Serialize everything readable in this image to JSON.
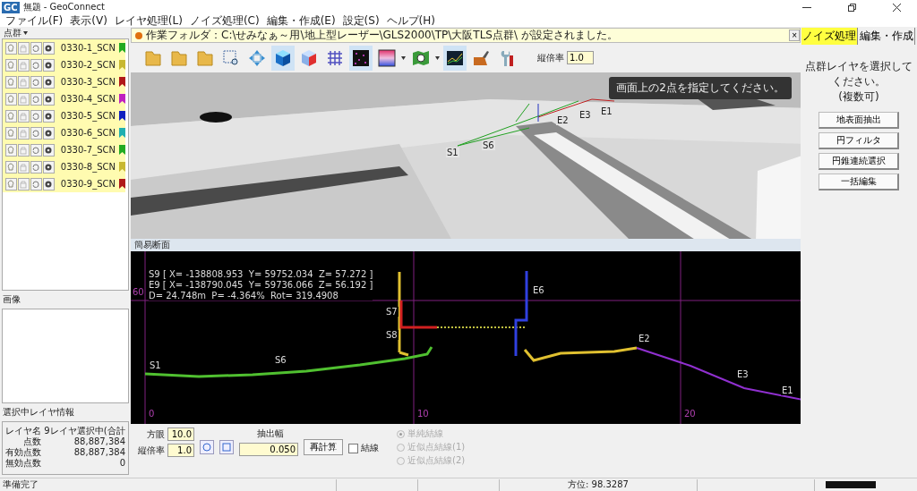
{
  "window": {
    "app_icon": "GC",
    "title": "無題 - GeoConnect"
  },
  "menu": [
    "ファイル(F)",
    "表示(V)",
    "レイヤ処理(L)",
    "ノイズ処理(C)",
    "編集・作成(E)",
    "設定(S)",
    "ヘルプ(H)"
  ],
  "left_panel": {
    "header": "点群",
    "layers": [
      {
        "name": "0330-1_SCN",
        "color": "#22aa22"
      },
      {
        "name": "0330-2_SCN",
        "color": "#c8b830"
      },
      {
        "name": "0330-3_SCN",
        "color": "#b01818"
      },
      {
        "name": "0330-4_SCN",
        "color": "#c020c0"
      },
      {
        "name": "0330-5_SCN",
        "color": "#1020c0"
      },
      {
        "name": "0330-6_SCN",
        "color": "#20b0b0"
      },
      {
        "name": "0330-7_SCN",
        "color": "#22aa22"
      },
      {
        "name": "0330-8_SCN",
        "color": "#c8b830"
      },
      {
        "name": "0330-9_SCN",
        "color": "#b01818"
      }
    ],
    "image_label": "画像",
    "info_label": "選択中レイヤ情報",
    "info": [
      {
        "label": "レイヤ名",
        "value": "9レイヤ選択中(合計"
      },
      {
        "label": "点数",
        "value": "88,887,384"
      },
      {
        "label": "有効点数",
        "value": "88,887,384"
      },
      {
        "label": "無効点数",
        "value": "0"
      }
    ]
  },
  "notice": {
    "text": "作業フォルダ：C:\\せみなぁ～用\\地上型レーザー\\GLS2000\\TP\\大阪TLS点群\\ が設定されました。",
    "close": "×"
  },
  "toolbar": {
    "scale_label": "縦倍率",
    "scale_value": "1.0"
  },
  "view3d": {
    "message": "画面上の2点を指定してください。",
    "points": [
      "S1",
      "S6",
      "E2",
      "E3",
      "E1"
    ]
  },
  "section": {
    "title": "簡易断面",
    "readout": [
      "S9 [ X= -138808.953  Y= 59752.034  Z= 57.272 ]",
      "E9 [ X= -138790.045  Y= 59736.066  Z= 56.192 ]",
      "D= 24.748m  P= -4.364%  Rot= 319.4908"
    ],
    "y_tick": "60",
    "x_ticks": [
      "0",
      "10",
      "20"
    ],
    "markers": [
      "S1",
      "S6",
      "S7",
      "S8",
      "E6",
      "E2",
      "E3",
      "E1"
    ]
  },
  "controls": {
    "grid_label": "方眼",
    "grid_value": "10.0",
    "scale_label": "縦倍率",
    "scale_value": "1.0",
    "width_label": "抽出幅",
    "width_value": "0.050",
    "recalc": "再計算",
    "connect": {
      "label": "結線",
      "checked": false
    },
    "modes_disabled": true,
    "modes": [
      {
        "label": "単純結線",
        "selected": true
      },
      {
        "label": "近似点結線(1)",
        "selected": false
      },
      {
        "label": "近似点結線(2)",
        "selected": false
      }
    ]
  },
  "right_panel": {
    "tabs": [
      {
        "label": "ノイズ処理",
        "selected": true
      },
      {
        "label": "編集・作成",
        "selected": false
      }
    ],
    "prompt": [
      "点群レイヤを選択してください。",
      "(複数可)"
    ],
    "buttons": [
      "地表面抽出",
      "円フィルタ",
      "円錐連続選択",
      "一括編集"
    ]
  },
  "status_bar": {
    "text": "準備完了",
    "bearing": "方位: 98.3287"
  }
}
